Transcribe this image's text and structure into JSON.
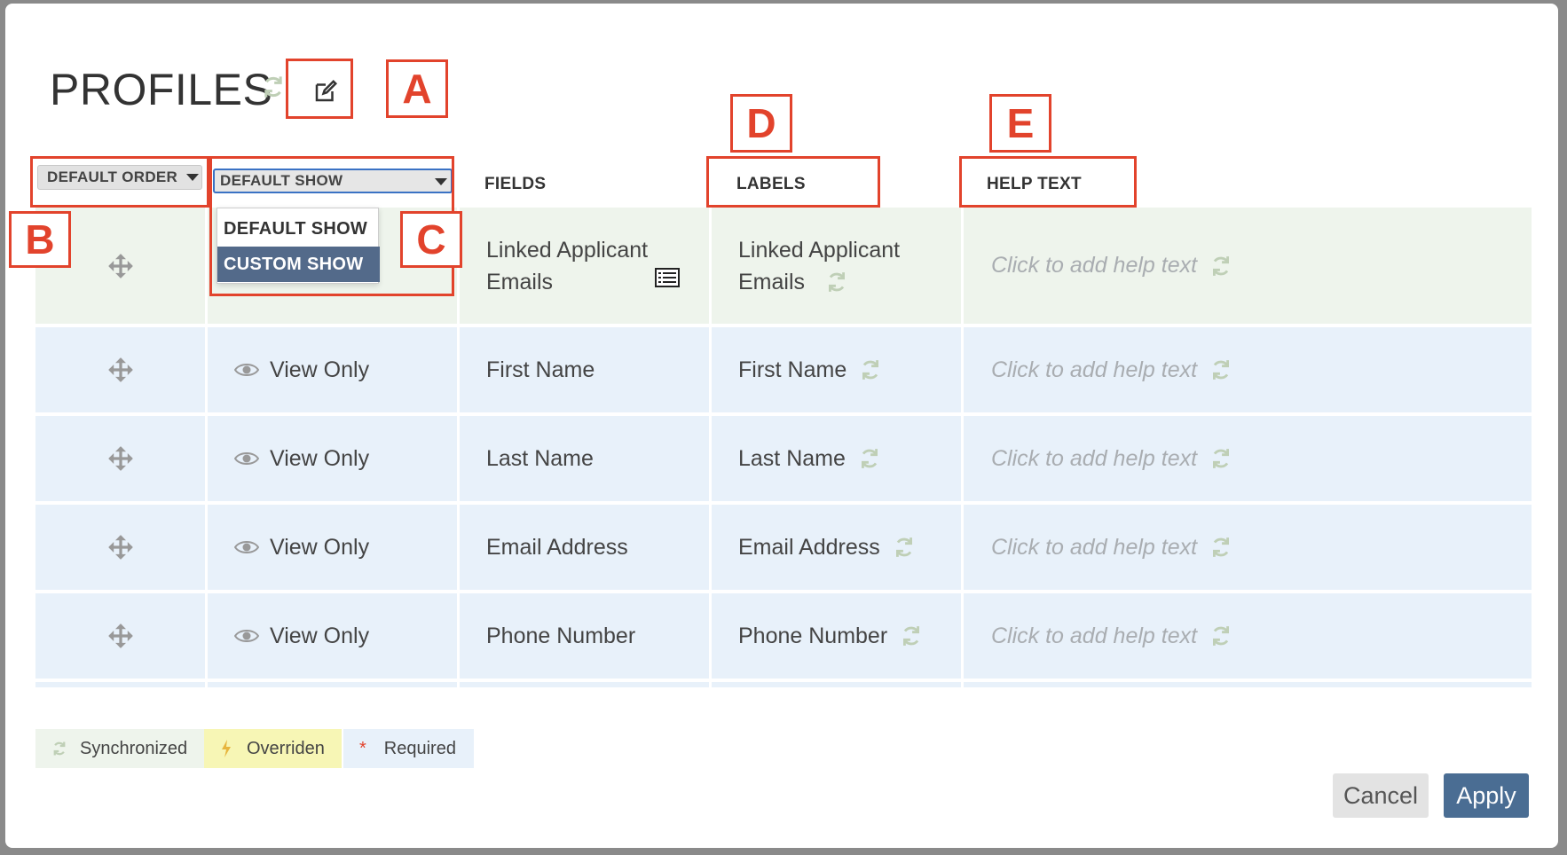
{
  "title": "PROFILES",
  "annotations": {
    "a": "A",
    "b": "B",
    "c": "C",
    "d": "D",
    "e": "E"
  },
  "headers": {
    "order_select": "DEFAULT ORDER",
    "show_select": "DEFAULT SHOW",
    "fields": "FIELDS",
    "labels": "LABELS",
    "help_text": "HELP TEXT"
  },
  "dropdown": {
    "options": [
      "DEFAULT SHOW",
      "CUSTOM SHOW"
    ],
    "highlighted": "CUSTOM SHOW"
  },
  "rows": [
    {
      "show": "",
      "field": "Linked Applicant Emails",
      "label": "Linked Applicant Emails",
      "help": "Click to add help text"
    },
    {
      "show": "View Only",
      "field": "First Name",
      "label": "First Name",
      "help": "Click to add help text"
    },
    {
      "show": "View Only",
      "field": "Last Name",
      "label": "Last Name",
      "help": "Click to add help text"
    },
    {
      "show": "View Only",
      "field": "Email Address",
      "label": "Email Address",
      "help": "Click to add help text"
    },
    {
      "show": "View Only",
      "field": "Phone Number",
      "label": "Phone Number",
      "help": "Click to add help text"
    }
  ],
  "legend": {
    "synchronized": "Synchronized",
    "overriden": "Overriden",
    "required_mark": "*",
    "required": "Required"
  },
  "buttons": {
    "cancel": "Cancel",
    "apply": "Apply"
  },
  "colors": {
    "annotation": "#e2432c",
    "apply": "#4a6d93",
    "sync_icon": "#bfcfb6",
    "override": "#f7f6b5",
    "highlight": "#536a8a"
  }
}
